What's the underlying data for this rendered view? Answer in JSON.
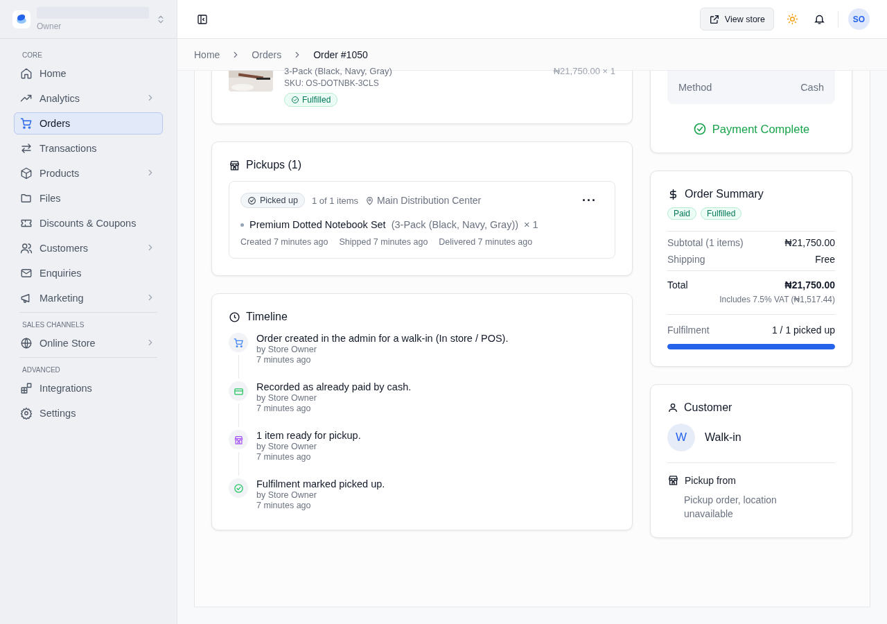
{
  "sidebar": {
    "account_role": "Owner",
    "sections": [
      {
        "title": "CORE",
        "items": [
          {
            "label": "Home",
            "kind": "home",
            "has_submenu": false,
            "selected": false
          },
          {
            "label": "Analytics",
            "kind": "trend",
            "has_submenu": true,
            "selected": false
          },
          {
            "label": "Orders",
            "kind": "cart",
            "has_submenu": false,
            "selected": true
          },
          {
            "label": "Transactions",
            "kind": "arrows",
            "has_submenu": false,
            "selected": false
          },
          {
            "label": "Products",
            "kind": "box",
            "has_submenu": true,
            "selected": false
          },
          {
            "label": "Files",
            "kind": "folder",
            "has_submenu": false,
            "selected": false
          },
          {
            "label": "Discounts & Coupons",
            "kind": "ticket",
            "has_submenu": false,
            "selected": false
          },
          {
            "label": "Customers",
            "kind": "users",
            "has_submenu": true,
            "selected": false
          },
          {
            "label": "Enquiries",
            "kind": "mail",
            "has_submenu": false,
            "selected": false
          },
          {
            "label": "Marketing",
            "kind": "megaphone",
            "has_submenu": true,
            "selected": false
          }
        ]
      },
      {
        "title": "SALES CHANNELS",
        "items": [
          {
            "label": "Online Store",
            "kind": "globe",
            "has_submenu": true,
            "selected": false
          }
        ]
      },
      {
        "title": "ADVANCED",
        "items": [
          {
            "label": "Integrations",
            "kind": "blocks",
            "has_submenu": false,
            "selected": false
          },
          {
            "label": "Settings",
            "kind": "gear",
            "has_submenu": false,
            "selected": false
          }
        ]
      }
    ]
  },
  "header": {
    "view_store": "View store",
    "avatar": "SO"
  },
  "breadcrumbs": [
    {
      "label": "Home",
      "current": false
    },
    {
      "label": "Orders",
      "current": false
    },
    {
      "label": "Order #1050",
      "current": true
    }
  ],
  "item_card": {
    "variant": "3-Pack (Black, Navy, Gray)",
    "sku": "SKU: OS-DOTNBK-3CLS",
    "status": "Fulfilled",
    "price": "₦21,750.00 × 1"
  },
  "pickups": {
    "title": "Pickups (1)",
    "status": "Picked up",
    "count": "1 of 1 items",
    "location": "Main Distribution Center",
    "more": "···",
    "item_name": "Premium Dotted Notebook Set",
    "item_variant": "(3-Pack (Black, Navy, Gray))",
    "item_qty": "× 1",
    "dates": [
      "Created 7 minutes ago",
      "Shipped 7 minutes ago",
      "Delivered 7 minutes ago"
    ]
  },
  "timeline": {
    "title": "Timeline",
    "events": [
      {
        "kind": "cart",
        "text": "Order created in the admin for a walk-in (In store / POS).",
        "by": "by Store Owner",
        "time": "7 minutes ago"
      },
      {
        "kind": "card",
        "text": "Recorded as already paid by cash.",
        "by": "by Store Owner",
        "time": "7 minutes ago"
      },
      {
        "kind": "store",
        "text": "1 item ready for pickup.",
        "by": "by Store Owner",
        "time": "7 minutes ago"
      },
      {
        "kind": "check",
        "text": "Fulfilment marked picked up.",
        "by": "by Store Owner",
        "time": "7 minutes ago"
      }
    ]
  },
  "payment": {
    "method_label": "Method",
    "method_value": "Cash",
    "status": "Payment Complete"
  },
  "summary": {
    "title": "Order Summary",
    "badges": [
      "Paid",
      "Fulfilled"
    ],
    "rows": [
      {
        "label": "Subtotal (1 items)",
        "value": "₦21,750.00"
      },
      {
        "label": "Shipping",
        "value": "Free"
      }
    ],
    "total_label": "Total",
    "total_value": "₦21,750.00",
    "vat": "Includes 7.5% VAT (₦1,517.44)",
    "fulfilment_label": "Fulfilment",
    "fulfilment_value": "1 / 1 picked up",
    "level": 1
  },
  "customer": {
    "title": "Customer",
    "initial": "W",
    "name": "Walk-in",
    "pickup_title": "Pickup from",
    "pickup_text": "Pickup order, location unavailable"
  }
}
